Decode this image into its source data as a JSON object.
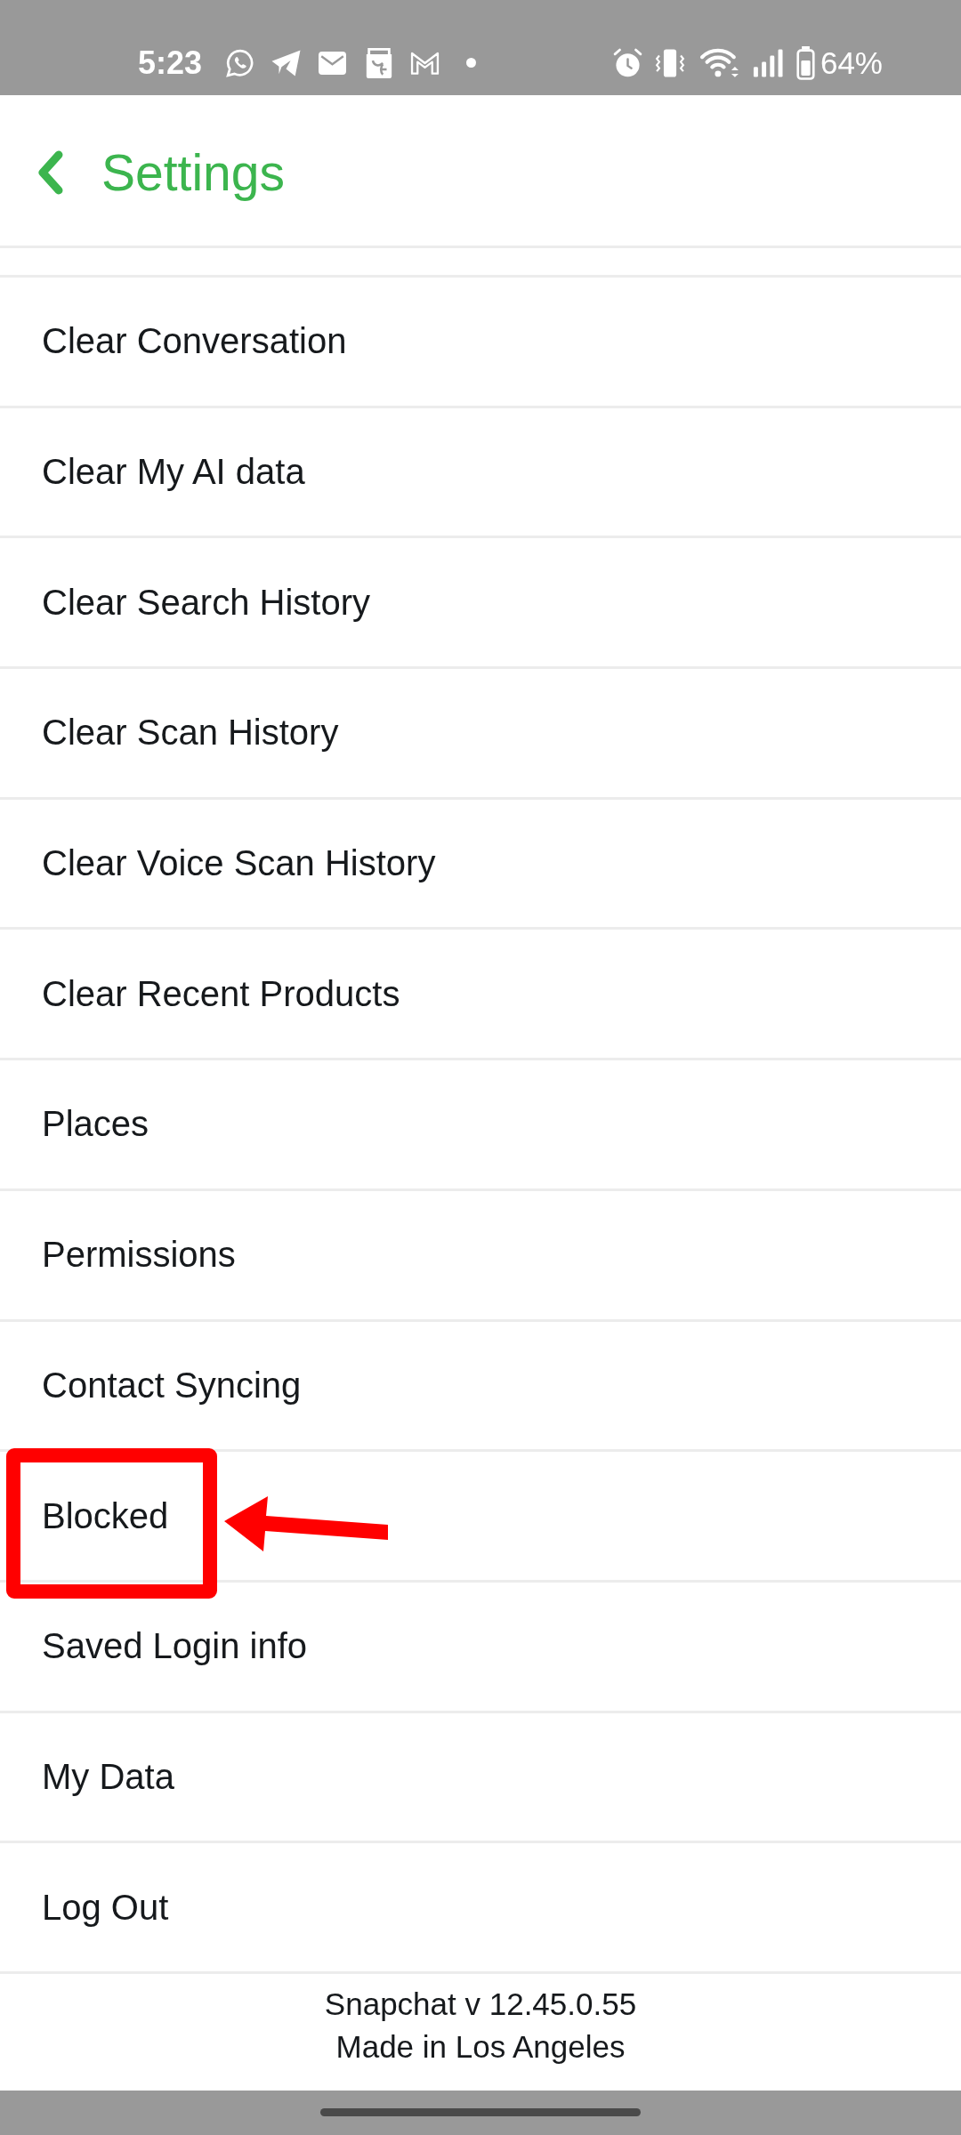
{
  "status_bar": {
    "time": "5:23",
    "battery": "64%"
  },
  "header": {
    "title": "Settings"
  },
  "items": [
    {
      "label": "Clear Conversation",
      "highlighted": false
    },
    {
      "label": "Clear My AI data",
      "highlighted": false
    },
    {
      "label": "Clear Search History",
      "highlighted": false
    },
    {
      "label": "Clear Scan History",
      "highlighted": false
    },
    {
      "label": "Clear Voice Scan History",
      "highlighted": false
    },
    {
      "label": "Clear Recent Products",
      "highlighted": false
    },
    {
      "label": "Places",
      "highlighted": false
    },
    {
      "label": "Permissions",
      "highlighted": false
    },
    {
      "label": "Contact Syncing",
      "highlighted": false
    },
    {
      "label": "Blocked",
      "highlighted": true
    },
    {
      "label": "Saved Login info",
      "highlighted": false
    },
    {
      "label": "My Data",
      "highlighted": false
    },
    {
      "label": "Log Out",
      "highlighted": false
    }
  ],
  "footer": {
    "lines": [
      "Snapchat v 12.45.0.55",
      "Made in Los Angeles"
    ]
  }
}
